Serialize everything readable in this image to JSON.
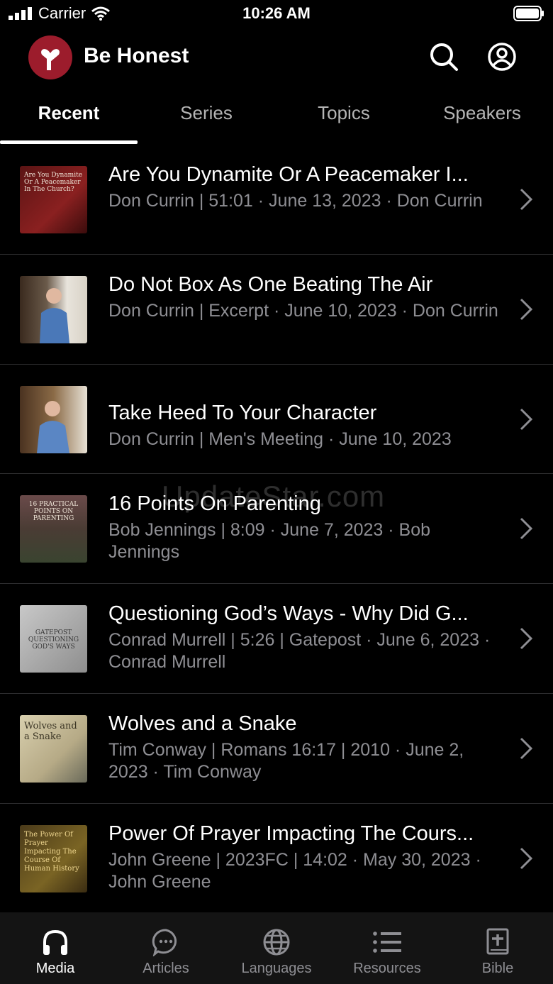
{
  "status_bar": {
    "carrier": "Carrier",
    "time": "10:26 AM"
  },
  "header": {
    "title": "Be Honest"
  },
  "tabs": [
    {
      "label": "Recent",
      "active": true
    },
    {
      "label": "Series",
      "active": false
    },
    {
      "label": "Topics",
      "active": false
    },
    {
      "label": "Speakers",
      "active": false
    }
  ],
  "items": [
    {
      "title": "Are You Dynamite Or A Peacemaker I...",
      "meta": "Don Currin | 51:01 · June 13, 2023 · Don Currin",
      "thumb_text": "Are You Dynamite Or A Peacemaker In The Church?"
    },
    {
      "title": "Do Not Box As One Beating The Air",
      "meta": "Don Currin | Excerpt · June 10, 2023 · Don Currin",
      "thumb_text": ""
    },
    {
      "title": "Take Heed To Your Character",
      "meta": "Don Currin | Men's Meeting · June 10, 2023",
      "thumb_text": ""
    },
    {
      "title": "16 Points On Parenting",
      "meta": "Bob Jennings | 8:09 · June 7, 2023 · Bob Jennings",
      "thumb_text": "16 PRACTICAL POINTS ON PARENTING"
    },
    {
      "title": "Questioning God’s Ways - Why Did G...",
      "meta": "Conrad Murrell | 5:26 | Gatepost · June 6, 2023 · Conrad Murrell",
      "thumb_text": "GATEPOST QUESTIONING GOD'S WAYS"
    },
    {
      "title": "Wolves and a Snake",
      "meta": "Tim Conway | Romans 16:17 | 2010 · June 2, 2023 · Tim Conway",
      "thumb_text": "Wolves and a Snake"
    },
    {
      "title": "Power Of Prayer Impacting The Cours...",
      "meta": "John Greene | 2023FC | 14:02 · May 30, 2023 · John Greene",
      "thumb_text": "The Power Of Prayer Impacting The Course Of Human History"
    }
  ],
  "tab_bar": [
    {
      "label": "Media",
      "icon": "headphones-icon",
      "active": true
    },
    {
      "label": "Articles",
      "icon": "chat-bubble-icon",
      "active": false
    },
    {
      "label": "Languages",
      "icon": "globe-icon",
      "active": false
    },
    {
      "label": "Resources",
      "icon": "list-icon",
      "active": false
    },
    {
      "label": "Bible",
      "icon": "bible-plus-icon",
      "active": false
    }
  ],
  "watermark": "UpdateStar.com",
  "colors": {
    "brand": "#9c1c2c",
    "muted": "#8e8e93",
    "background": "#000000"
  }
}
